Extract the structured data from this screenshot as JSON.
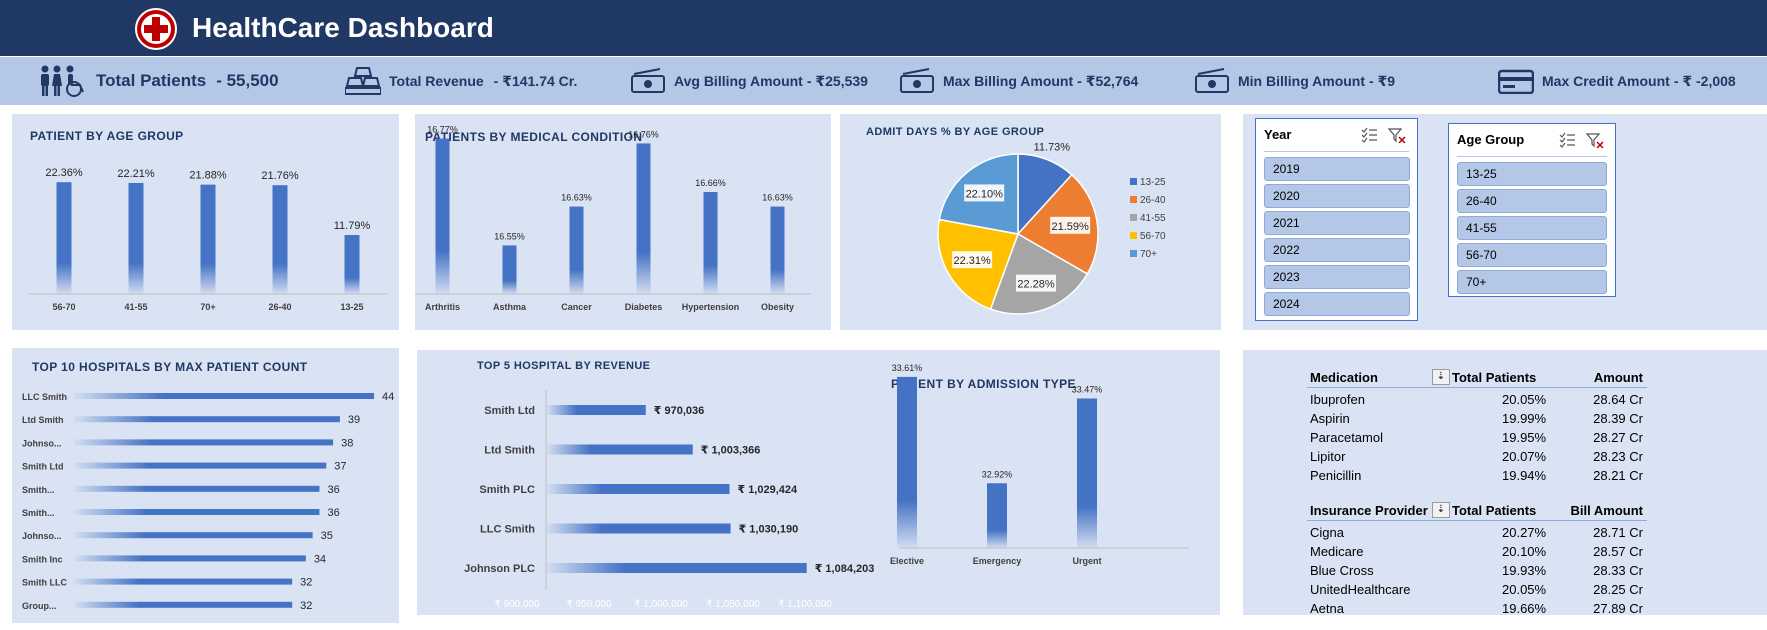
{
  "header": {
    "title": "HealthCare Dashboard",
    "logo_icon": "medical-cross-icon"
  },
  "kpis": {
    "total_patients": {
      "label": "Total Patients",
      "value": "- 55,500"
    },
    "total_revenue": {
      "label": "Total Revenue",
      "value": "- ₹141.74 Cr."
    },
    "avg_billing": {
      "label": "Avg Billing Amount",
      "value": "- ₹25,539"
    },
    "max_billing": {
      "label": "Max Billing Amount",
      "value": "- ₹52,764"
    },
    "min_billing": {
      "label": "Min Billing Amount",
      "value": "- ₹9"
    },
    "max_credit": {
      "label": "Max Credit Amount",
      "value": "- ₹ -2,008"
    }
  },
  "panels": {
    "age_group": "PATIENT BY AGE GROUP",
    "medical_condition": "PATIENTS BY MEDICAL CONDITION",
    "admit_days": "ADMIT DAYS % BY AGE GROUP",
    "top_hospitals": "TOP 10 HOSPITALS BY MAX PATIENT COUNT",
    "top_revenue": "TOP 5 HOSPITAL BY REVENUE",
    "admission_type": "PATIENT BY ADMISSION TYPE"
  },
  "chart_data": [
    {
      "id": "age_group",
      "type": "bar",
      "title": "PATIENT BY AGE GROUP",
      "categories": [
        "56-70",
        "41-55",
        "70+",
        "26-40",
        "13-25"
      ],
      "values": [
        22.36,
        22.21,
        21.88,
        21.76,
        11.79
      ],
      "labels": [
        "22.36%",
        "22.21%",
        "21.88%",
        "21.76%",
        "11.79%"
      ],
      "ylim": [
        0,
        25
      ]
    },
    {
      "id": "medical_condition",
      "type": "bar",
      "title": "PATIENTS BY MEDICAL CONDITION",
      "categories": [
        "Arthritis",
        "Asthma",
        "Cancer",
        "Diabetes",
        "Hypertension",
        "Obesity"
      ],
      "values": [
        16.77,
        16.55,
        16.63,
        16.76,
        16.66,
        16.63
      ],
      "labels": [
        "16.77%",
        "16.55%",
        "16.63%",
        "16.76%",
        "16.66%",
        "16.63%"
      ],
      "ylim": [
        16.45,
        16.8
      ]
    },
    {
      "id": "admit_days",
      "type": "pie",
      "title": "ADMIT DAYS % BY AGE GROUP",
      "categories": [
        "13-25",
        "26-40",
        "41-55",
        "56-70",
        "70+"
      ],
      "values": [
        11.73,
        21.59,
        22.28,
        22.31,
        22.1
      ],
      "labels": [
        "11.73%",
        "21.59%",
        "22.28%",
        "22.31%",
        "22.10%"
      ],
      "colors": [
        "#4472c4",
        "#ed7d31",
        "#a5a5a5",
        "#ffc000",
        "#5b9bd5"
      ],
      "legend": "right"
    },
    {
      "id": "top_hospitals",
      "type": "bar",
      "orientation": "horizontal",
      "title": "TOP 10 HOSPITALS BY MAX PATIENT COUNT",
      "categories": [
        "LLC Smith",
        "Ltd Smith",
        "Johnso...",
        "Smith Ltd",
        "Smith...",
        "Smith...",
        "Johnso...",
        "Smith Inc",
        "Smith LLC",
        "Group..."
      ],
      "values": [
        44,
        39,
        38,
        37,
        36,
        36,
        35,
        34,
        32,
        32
      ],
      "labels": [
        "44",
        "39",
        "38",
        "37",
        "36",
        "36",
        "35",
        "34",
        "32",
        "32"
      ],
      "xlim": [
        0,
        44
      ]
    },
    {
      "id": "top_revenue",
      "type": "bar",
      "orientation": "horizontal",
      "title": "TOP 5 HOSPITAL BY REVENUE",
      "categories": [
        "Smith Ltd",
        "Ltd Smith",
        "Smith PLC",
        "LLC Smith",
        "Johnson PLC"
      ],
      "values": [
        970036,
        1003366,
        1029424,
        1030190,
        1084203
      ],
      "labels": [
        "₹ 970,036",
        "₹ 1,003,366",
        "₹ 1,029,424",
        "₹ 1,030,190",
        "₹ 1,084,203"
      ],
      "ticks": [
        "₹ 900,000",
        "₹ 950,000",
        "₹ 1,000,000",
        "₹ 1,050,000",
        "₹ 1,100,000"
      ],
      "xlim": [
        900000,
        1100000
      ]
    },
    {
      "id": "admission_type",
      "type": "bar",
      "title": "PATIENT BY ADMISSION TYPE",
      "categories": [
        "Elective",
        "Emergency",
        "Urgent"
      ],
      "values": [
        33.61,
        32.92,
        33.47
      ],
      "labels": [
        "33.61%",
        "32.92%",
        "33.47%"
      ],
      "ylim": [
        32.5,
        33.7
      ]
    }
  ],
  "slicers": {
    "year": {
      "title": "Year",
      "items": [
        "2019",
        "2020",
        "2021",
        "2022",
        "2023",
        "2024"
      ]
    },
    "age_group": {
      "title": "Age Group",
      "items": [
        "13-25",
        "26-40",
        "41-55",
        "56-70",
        "70+"
      ]
    }
  },
  "tables": {
    "medication": {
      "headers": [
        "Medication",
        "Total Patients",
        "Amount"
      ],
      "rows": [
        [
          "Ibuprofen",
          "20.05%",
          "28.64 Cr"
        ],
        [
          "Aspirin",
          "19.99%",
          "28.39 Cr"
        ],
        [
          "Paracetamol",
          "19.95%",
          "28.27 Cr"
        ],
        [
          "Lipitor",
          "20.07%",
          "28.23 Cr"
        ],
        [
          "Penicillin",
          "19.94%",
          "28.21 Cr"
        ]
      ]
    },
    "insurance": {
      "headers": [
        "Insurance Provider",
        "Total Patients",
        "Bill Amount"
      ],
      "rows": [
        [
          "Cigna",
          "20.27%",
          "28.71 Cr"
        ],
        [
          "Medicare",
          "20.10%",
          "28.57 Cr"
        ],
        [
          "Blue Cross",
          "19.93%",
          "28.33 Cr"
        ],
        [
          "UnitedHealthcare",
          "20.05%",
          "28.25 Cr"
        ],
        [
          "Aetna",
          "19.66%",
          "27.89 Cr"
        ]
      ]
    }
  }
}
